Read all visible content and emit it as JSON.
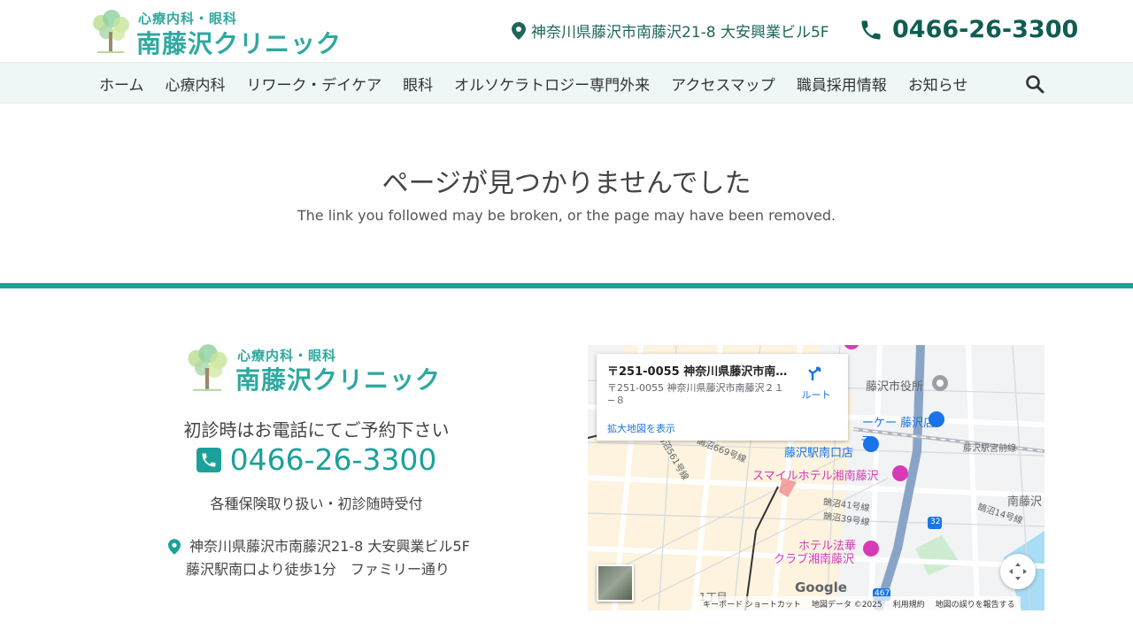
{
  "header": {
    "logo_sub": "心療内科・眼科",
    "logo_main": "南藤沢クリニック",
    "address": "神奈川県藤沢市南藤沢21-8 大安興業ビル5F",
    "phone": "0466-26-3300"
  },
  "nav": {
    "items": [
      {
        "label": "ホーム"
      },
      {
        "label": "心療内科"
      },
      {
        "label": "リワーク・デイケア"
      },
      {
        "label": "眼科"
      },
      {
        "label": "オルソケラトロジー専門外来"
      },
      {
        "label": "アクセスマップ"
      },
      {
        "label": "職員採用情報"
      },
      {
        "label": "お知らせ"
      }
    ],
    "search_icon": "search-icon"
  },
  "main": {
    "title": "ページが見つかりませんでした",
    "subtitle": "The link you followed may be broken, or the page may have been removed."
  },
  "footer": {
    "logo_sub": "心療内科・眼科",
    "logo_main": "南藤沢クリニック",
    "reservation": "初診時はお電話にてご予約下さい",
    "phone": "0466-26-3300",
    "insurance": "各種保険取り扱い・初診随時受付",
    "address_line1": "神奈川県藤沢市南藤沢21-8 大安興業ビル5F",
    "address_line2": "藤沢駅南口より徒歩1分　ファミリー通り"
  },
  "map": {
    "card_title": "〒251-0055 神奈川県藤沢市南…",
    "card_address": "〒251-0055 神奈川県藤沢市南藤沢２１−８",
    "route_label": "ルート",
    "enlarge_link": "拡大地図を表示",
    "google": "Google",
    "footer_shortcuts": "キーボード ショートカット",
    "footer_data": "地図データ ©2025",
    "footer_terms": "利用規約",
    "footer_report": "地図の誤りを報告する",
    "labels": {
      "city_hall": "藤沢市役所",
      "shop": "ーケー 藤沢店",
      "hotel_top1": "テ",
      "hotel_top2": "藤沢駅南口店",
      "smile_hotel": "スマイルホテル湘南藤沢",
      "hotel_hokke1": "ホテル法華",
      "hotel_hokke2": "クラブ湘南藤沢",
      "street_miyamae": "藤沢駅宮前線",
      "street_14": "鵠沼14号線",
      "street_41": "鵠沼41号線",
      "street_39": "鵠沼39号線",
      "street_669": "鵠沼669号線",
      "street_561": "鵠沼561号線",
      "area_minami": "南藤沢",
      "chome": "1丁目",
      "route_32": "32",
      "route_467": "467"
    }
  },
  "colors": {
    "accent": "#1ba19a",
    "brand_dark": "#0f5d52",
    "nav_bg": "#eff7f6"
  }
}
